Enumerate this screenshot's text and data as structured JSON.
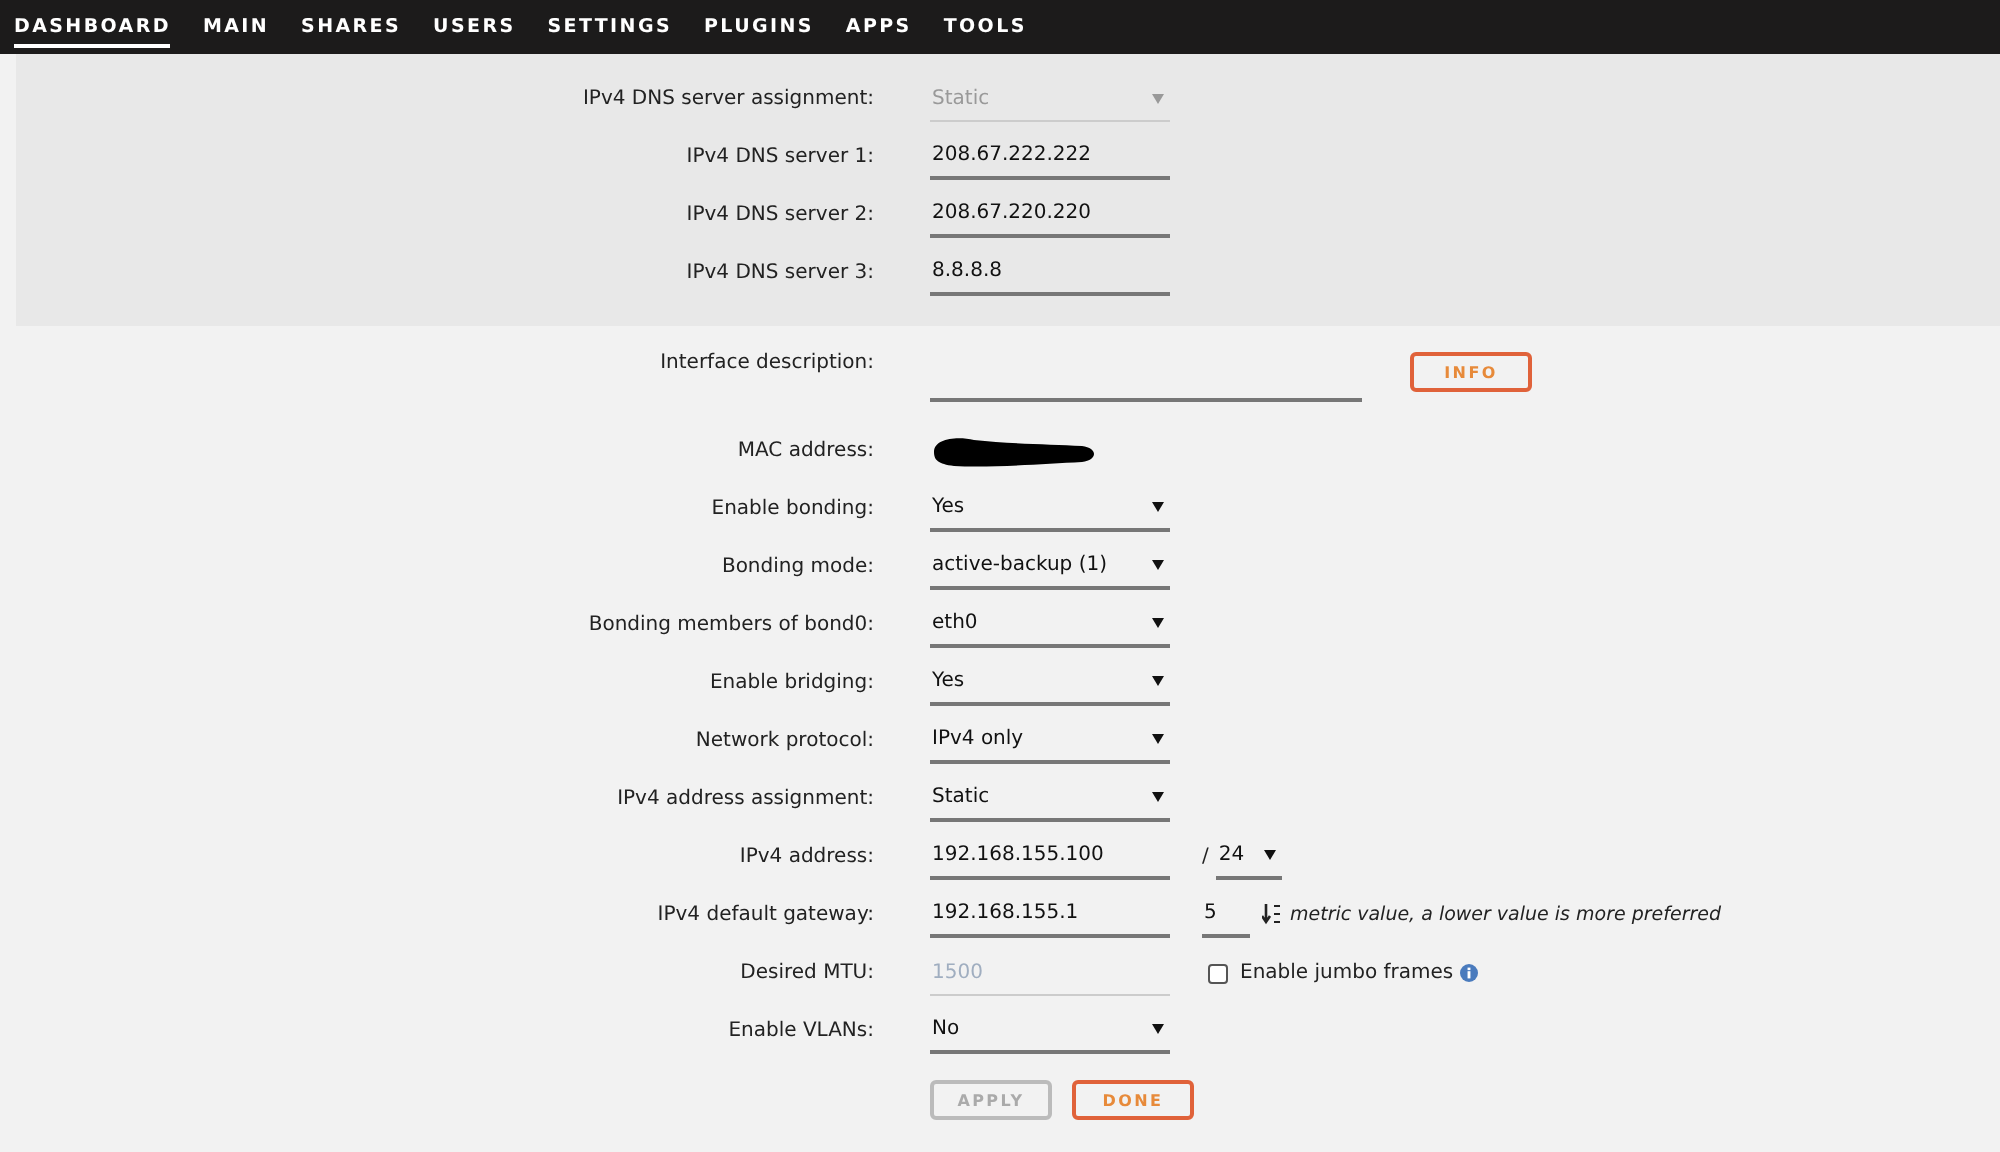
{
  "nav": [
    {
      "label": "DASHBOARD",
      "selected": true
    },
    {
      "label": "MAIN",
      "selected": false
    },
    {
      "label": "SHARES",
      "selected": false
    },
    {
      "label": "USERS",
      "selected": false
    },
    {
      "label": "SETTINGS",
      "selected": false
    },
    {
      "label": "PLUGINS",
      "selected": false
    },
    {
      "label": "APPS",
      "selected": false
    },
    {
      "label": "TOOLS",
      "selected": false
    }
  ],
  "dns_rows": [
    {
      "kind": "select",
      "label": "IPv4 DNS server assignment:",
      "value": "Static",
      "disabled": true
    },
    {
      "kind": "text",
      "label": "IPv4 DNS server 1:",
      "value": "208.67.222.222"
    },
    {
      "kind": "text",
      "label": "IPv4 DNS server 2:",
      "value": "208.67.220.220"
    },
    {
      "kind": "text",
      "label": "IPv4 DNS server 3:",
      "value": "8.8.8.8"
    }
  ],
  "rows": [
    {
      "kind": "description",
      "label": "Interface description:",
      "button": "INFO"
    },
    {
      "kind": "redacted",
      "label": "MAC address:"
    },
    {
      "kind": "select",
      "label": "Enable bonding:",
      "value": "Yes",
      "disabled": false
    },
    {
      "kind": "select",
      "label": "Bonding mode:",
      "value": "active-backup (1)",
      "disabled": false
    },
    {
      "kind": "select",
      "label": "Bonding members of bond0:",
      "value": "eth0",
      "disabled": false
    },
    {
      "kind": "select",
      "label": "Enable bridging:",
      "value": "Yes",
      "disabled": false
    },
    {
      "kind": "select",
      "label": "Network protocol:",
      "value": "IPv4 only",
      "disabled": false
    },
    {
      "kind": "select",
      "label": "IPv4 address assignment:",
      "value": "Static",
      "disabled": false
    },
    {
      "kind": "cidr",
      "label": "IPv4 address:",
      "value": "192.168.155.100",
      "slash": "/",
      "mask": "24"
    },
    {
      "kind": "metric",
      "label": "IPv4 default gateway:",
      "value": "192.168.155.1",
      "metric": "5",
      "hint": "metric value, a lower value is more preferred"
    },
    {
      "kind": "mtu",
      "label": "Desired MTU:",
      "placeholder": "1500",
      "checkbox_label": "Enable jumbo frames",
      "checked": false
    },
    {
      "kind": "select",
      "label": "Enable VLANs:",
      "value": "No",
      "disabled": false
    }
  ],
  "buttons": [
    {
      "label": "APPLY",
      "disabled": true
    },
    {
      "label": "DONE",
      "disabled": false
    }
  ]
}
